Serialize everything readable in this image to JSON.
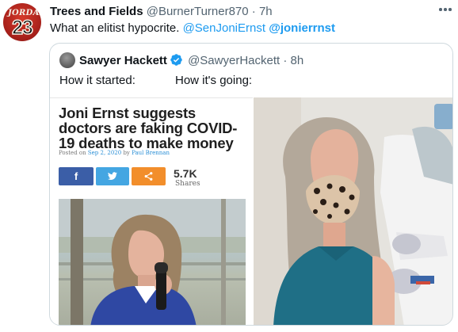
{
  "tweet": {
    "display_name": "Trees and Fields",
    "handle": "@BurnerTurner870",
    "separator": "·",
    "time": "7h",
    "text_prefix": "What an elitist hypocrite. ",
    "mention_1": "@SenJoniErnst",
    "mention_2": "@jonierrnst",
    "avatar": {
      "jersey_name": "JORDAN",
      "jersey_number": "23"
    },
    "more_icon": "more-horizontal-icon"
  },
  "quote": {
    "display_name": "Sawyer Hackett",
    "verified_icon": "verified-badge-icon",
    "handle": "@SawyerHackett",
    "separator": "·",
    "time": "8h",
    "text_left": "How it started:",
    "text_right": "How it's going:"
  },
  "article": {
    "headline": "Joni Ernst suggests doctors are faking COVID-19 deaths to make money",
    "byline_prefix": "Posted on ",
    "byline_date": "Sep 2, 2020",
    "byline_mid": " by ",
    "byline_author": "Paul Brennan",
    "share_facebook_icon": "f",
    "share_twitter_icon": "twitter-bird-icon",
    "share_generic_icon": "share-icon",
    "share_count": "5.7K",
    "share_label": "Shares"
  },
  "colors": {
    "accent": "#1d9bf0",
    "facebook": "#3b5ea7",
    "twitter": "#44a6e2",
    "share": "#f28e2b"
  }
}
